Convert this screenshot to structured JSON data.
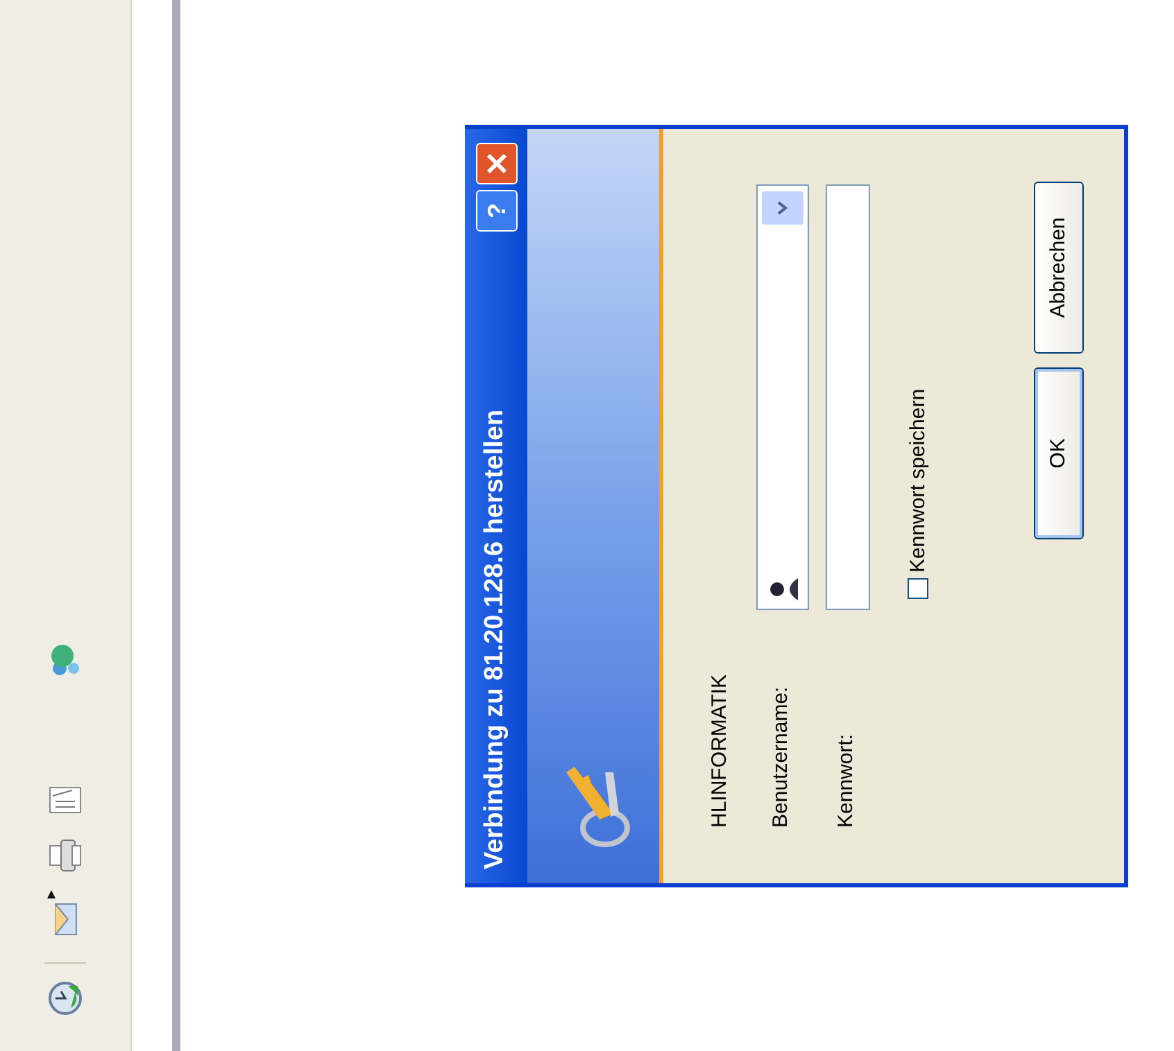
{
  "dialog": {
    "title": "Verbindung zu 81.20.128.6 herstellen",
    "help": "?",
    "server": "HLINFORMATIK",
    "username": {
      "label": "Benutzername:"
    },
    "password": {
      "label": "Kennwort:"
    },
    "remember": {
      "label": "Kennwort speichern",
      "checked": false
    },
    "buttons": [
      {
        "label": "OK",
        "default": true
      },
      {
        "label": "Abbrechen",
        "default": false
      }
    ]
  }
}
